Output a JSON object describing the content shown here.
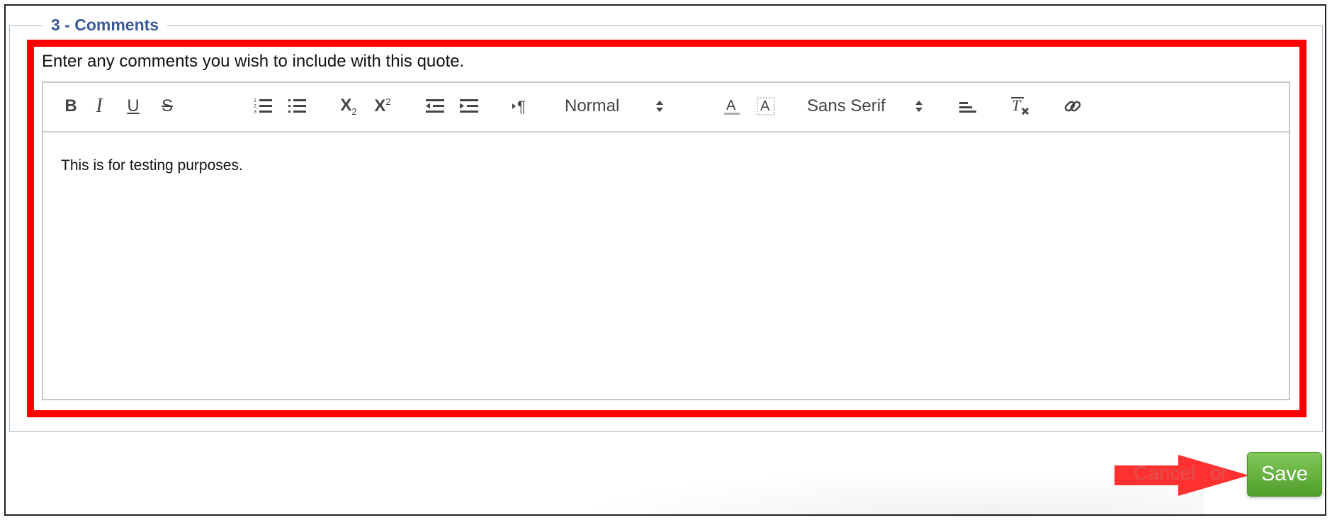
{
  "section": {
    "legend": "3 - Comments",
    "instructions": "Enter any comments you wish to include with this quote."
  },
  "toolbar": {
    "bold_label": "B",
    "italic_label": "I",
    "underline_label": "U",
    "strike_label": "S",
    "subscript_label": "X",
    "subscript_sub": "2",
    "superscript_label": "X",
    "superscript_sup": "2",
    "header_picker": "Normal",
    "font_picker": "Sans Serif",
    "icons": [
      "bold-icon",
      "italic-icon",
      "underline-icon",
      "strikethrough-icon",
      "ordered-list-icon",
      "bullet-list-icon",
      "subscript-icon",
      "superscript-icon",
      "outdent-icon",
      "indent-icon",
      "paragraph-direction-icon",
      "text-color-icon",
      "background-color-icon",
      "align-icon",
      "clear-format-icon",
      "link-icon"
    ]
  },
  "editor": {
    "content": "This is for testing purposes."
  },
  "actions": {
    "cancel_label": "Cancel",
    "or_label": "or",
    "save_label": "Save"
  },
  "colors": {
    "legend": "#3b5998",
    "highlight": "#ff0000",
    "save_button": "#5aa832",
    "arrow": "#ff2020"
  }
}
